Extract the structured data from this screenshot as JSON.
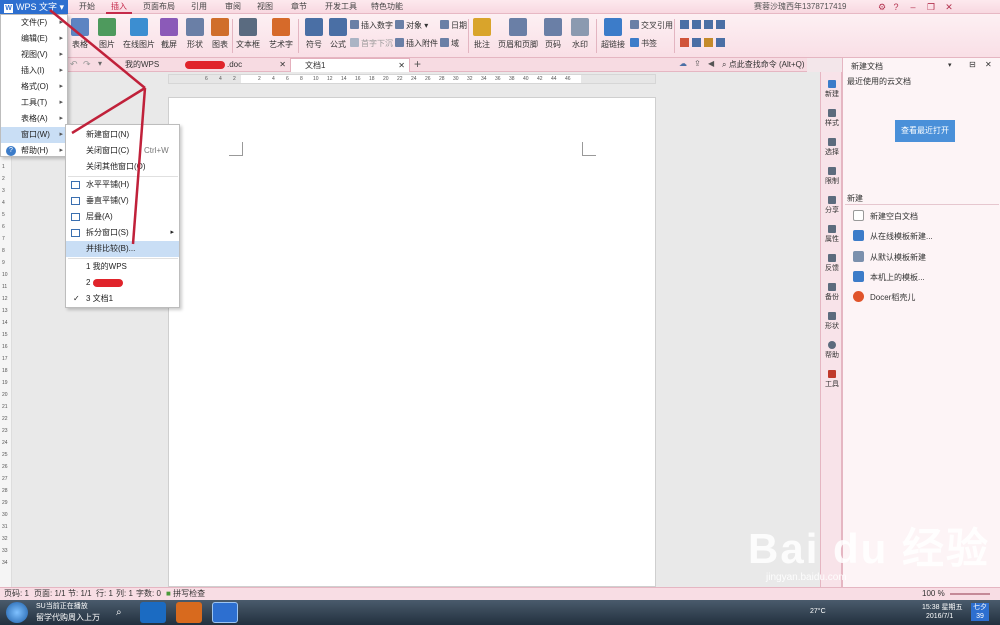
{
  "app": {
    "name": "WPS 文字",
    "user": "赛蓉沙瑰西年13787174​19"
  },
  "menu_tabs": [
    "开始",
    "插入",
    "页面布局",
    "引用",
    "审阅",
    "视图",
    "章节",
    "开发工具",
    "特色功能"
  ],
  "active_menu_tab": "插入",
  "ribbon": {
    "big": [
      "表格",
      "图片",
      "在线图片",
      "截屏",
      "形状",
      "图表",
      "文本框",
      "艺术字",
      "符号",
      "公式"
    ],
    "small1": [
      "插入数字",
      "首字下沉"
    ],
    "small2": [
      "对象",
      "插入附件"
    ],
    "small3": [
      "日期",
      "域"
    ],
    "big2": [
      "批注",
      "页眉和页脚",
      "页码",
      "水印",
      "超链接"
    ],
    "small4": [
      "交叉引用",
      "书签"
    ]
  },
  "doc_tabs": [
    {
      "label": "我的WPS"
    },
    {
      "label": ".doc"
    },
    {
      "label": "文档1"
    }
  ],
  "search_hint": "点此查找命令 (Alt+Q)",
  "ruler_h": [
    "6",
    "4",
    "2",
    "2",
    "4",
    "6",
    "8",
    "10",
    "12",
    "14",
    "16",
    "18",
    "20",
    "22",
    "24",
    "26",
    "28",
    "30",
    "32",
    "34",
    "36",
    "38",
    "40",
    "42",
    "44",
    "46"
  ],
  "ruler_v": [
    "1",
    "2",
    "3",
    "4",
    "5",
    "6",
    "7",
    "8",
    "9",
    "10",
    "11",
    "12",
    "13",
    "14",
    "15",
    "16",
    "17",
    "18",
    "19",
    "20",
    "21",
    "22",
    "23",
    "24",
    "25",
    "26",
    "27",
    "28",
    "29",
    "30",
    "31",
    "32",
    "33",
    "34"
  ],
  "main_menu": [
    {
      "label": "文件(F)"
    },
    {
      "label": "编辑(E)"
    },
    {
      "label": "视图(V)"
    },
    {
      "label": "插入(I)"
    },
    {
      "label": "格式(O)"
    },
    {
      "label": "工具(T)"
    },
    {
      "label": "表格(A)"
    },
    {
      "label": "窗口(W)"
    },
    {
      "label": "帮助(H)"
    }
  ],
  "window_menu": {
    "new": "新建窗口(N)",
    "close": "关闭窗口(C)",
    "close_shortcut": "Ctrl+W",
    "close_others": "关闭其他窗口(O)",
    "tile_h": "水平平铺(H)",
    "tile_v": "垂直平铺(V)",
    "cascade": "层叠(A)",
    "split": "拆分窗口(S)",
    "compare": "并排比较(B)...",
    "doc1": "1 我的WPS",
    "doc2": "2 .doc",
    "doc3": "3 文档1",
    "check": "✓"
  },
  "right_toolbar": [
    "新建",
    "样式",
    "选择",
    "限制",
    "分享",
    "属性",
    "反馈",
    "备份",
    "形状",
    "帮助",
    "工具"
  ],
  "right_panel": {
    "title": "新建文档",
    "recent_label": "最近使用的云文档",
    "recent_button": "查看最近打开",
    "new_label": "新建",
    "items": [
      "新建空白文档",
      "从在线模板新建...",
      "从默认模板新建",
      "本机上的模板...",
      "Docer稻壳儿"
    ]
  },
  "status": {
    "page": "页码: 1",
    "pages": "页面: 1/1",
    "section": "节: 1/1",
    "row": "行: 1",
    "col": "列: 1",
    "words": "字数: 0",
    "spell": "拼写检查",
    "zoom": "100 %"
  },
  "taskbar": {
    "task1": "SU当前正在播放",
    "task2": "留学代购周入上万",
    "weather": "27°C",
    "time": "15:38 星期五",
    "date": "2016/7/1",
    "badge": "七夕 39"
  },
  "watermark": {
    "main": "Bai du 经验",
    "sub": "jingyan.baidu.com"
  },
  "colors": {
    "accent": "#c52a4a",
    "menu_highlight": "#c9def5",
    "app_button": "#2d6fd0"
  }
}
